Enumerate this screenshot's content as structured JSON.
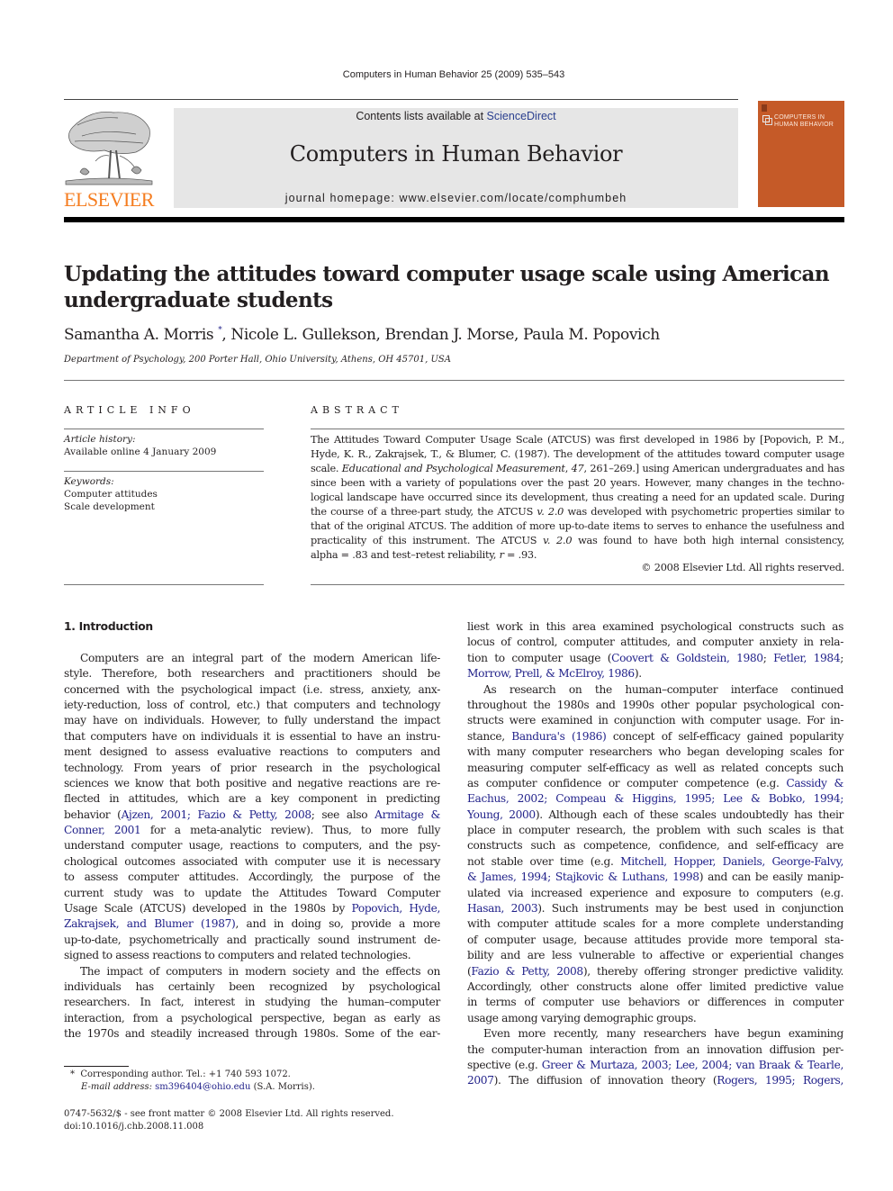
{
  "running_head": "Computers in Human Behavior 25 (2009) 535–543",
  "publisher": {
    "logo_word": "ELSEVIER",
    "logo_color": "#f57d20"
  },
  "masthead": {
    "contents_prefix": "Contents lists available at ",
    "contents_link": "ScienceDirect",
    "journal_title": "Computers in Human Behavior",
    "homepage": "journal homepage: www.elsevier.com/locate/comphumbeh",
    "background": "#e6e6e6"
  },
  "cover": {
    "title_line1": "COMPUTERS IN",
    "title_line2": "HUMAN BEHAVIOR",
    "color": "#c55a28"
  },
  "article": {
    "title": "Updating the attitudes toward computer usage scale using American undergraduate students",
    "authors": {
      "first": "Samantha A. Morris",
      "first_mark": "*",
      "rest": ", Nicole L. Gullekson, Brendan J. Morse, Paula M. Popovich"
    },
    "affiliation": "Department of Psychology, 200 Porter Hall, Ohio University, Athens, OH 45701, USA"
  },
  "article_info": {
    "heading": "ARTICLE INFO",
    "history_label": "Article history:",
    "history_value": "Available online 4 January 2009",
    "keywords_label": "Keywords:",
    "keywords": [
      "Computer attitudes",
      "Scale development"
    ]
  },
  "abstract": {
    "heading": "ABSTRACT",
    "lines": [
      "The Attitudes Toward Computer Usage Scale (ATCUS) was first developed in 1986 by [Popovich, P. M.,",
      "Hyde, K. R., Zakrajsek, T., & Blumer, C. (1987). The development of the attitudes toward computer usage",
      [
        "scale. ",
        {
          "i": "Educational and Psychological Measurement"
        },
        ", ",
        {
          "i": "47"
        },
        ", 261–269.] using American undergraduates and has"
      ],
      "since been with a variety of populations over the past 20 years. However, many changes in the techno-",
      "logical landscape have occurred since its development, thus creating a need for an updated scale. During",
      [
        "the course of a three-part study, the ATCUS ",
        {
          "i": "v. 2.0"
        },
        " was developed with psychometric properties similar to"
      ],
      "that of the original ATCUS. The addition of more up-to-date items to serves to enhance the usefulness and",
      [
        "practicality of this instrument. The ATCUS ",
        {
          "i": "v. 2.0"
        },
        " was found to have both high internal consistency,"
      ],
      [
        "alpha = .83 and test–retest reliability, ",
        {
          "i": "r"
        },
        " = .93."
      ]
    ],
    "copyright": "© 2008 Elsevier Ltd. All rights reserved."
  },
  "body": {
    "section_heading": "1. Introduction",
    "left_col": [
      {
        "t": "Computers are an integral part of the modern American life-",
        "ind": true
      },
      {
        "t": "style. Therefore, both researchers and practitioners should be"
      },
      {
        "t": "concerned with the psychological impact (i.e. stress, anxiety, anx-"
      },
      {
        "t": "iety-reduction, loss of control, etc.) that computers and technology"
      },
      {
        "t": "may have on individuals. However, to fully understand the impact"
      },
      {
        "t": "that computers have on individuals it is essential to have an instru-"
      },
      {
        "t": "ment designed to assess evaluative reactions to computers and"
      },
      {
        "t": "technology. From years of prior research in the psychological"
      },
      {
        "t": "sciences we know that both positive and negative reactions are re-"
      },
      {
        "t": "flected in attitudes, which are a key component in predicting"
      },
      {
        "p": [
          "behavior (",
          {
            "l": "Ajzen, 2001; Fazio & Petty, 2008"
          },
          "; see also ",
          {
            "l": "Armitage &"
          }
        ]
      },
      {
        "p": [
          {
            "l": "Conner, 2001"
          },
          " for a meta-analytic review). Thus, to more fully"
        ]
      },
      {
        "t": "understand computer usage, reactions to computers, and the psy-"
      },
      {
        "t": "chological outcomes associated with computer use it is necessary"
      },
      {
        "t": "to assess computer attitudes. Accordingly, the purpose of the"
      },
      {
        "t": "current study was to update the Attitudes Toward Computer"
      },
      {
        "p": [
          "Usage Scale (ATCUS) developed in the 1980s by ",
          {
            "l": "Popovich, Hyde,"
          }
        ]
      },
      {
        "p": [
          {
            "l": "Zakrajsek, and Blumer (1987)"
          },
          ", and in doing so, provide a more"
        ]
      },
      {
        "t": "up-to-date, psychometrically and practically sound instrument de-"
      },
      {
        "t": "signed to assess reactions to computers and related technologies.",
        "last": true
      },
      {
        "t": "The impact of computers in modern society and the effects on",
        "ind": true
      },
      {
        "t": "individuals has certainly been recognized by psychological"
      },
      {
        "t": "researchers. In fact, interest in studying the human–computer"
      },
      {
        "t": "interaction, from a psychological perspective, began as early as"
      },
      {
        "t": "the 1970s and steadily increased through 1980s. Some of the ear-"
      }
    ],
    "right_col": [
      {
        "t": "liest work in this area examined psychological constructs such as"
      },
      {
        "t": "locus of control, computer attitudes, and computer anxiety in rela-"
      },
      {
        "p": [
          "tion to computer usage (",
          {
            "l": "Coovert & Goldstein, 1980"
          },
          "; ",
          {
            "l": "Fetler, 1984"
          },
          ";"
        ]
      },
      {
        "p": [
          {
            "l": "Morrow, Prell, & McElroy, 1986"
          },
          ")."
        ],
        "last": true
      },
      {
        "t": "As research on the human–computer interface continued",
        "ind": true
      },
      {
        "t": "throughout the 1980s and 1990s other popular psychological con-"
      },
      {
        "t": "structs were examined in conjunction with computer usage. For in-"
      },
      {
        "p": [
          "stance, ",
          {
            "l": "Bandura's (1986)"
          },
          " concept of self-efficacy gained popularity"
        ]
      },
      {
        "t": "with many computer researchers who began developing scales for"
      },
      {
        "t": "measuring computer self-efficacy as well as related concepts such"
      },
      {
        "p": [
          "as computer confidence or computer competence (e.g. ",
          {
            "l": "Cassidy &"
          }
        ]
      },
      {
        "p": [
          {
            "l": "Eachus, 2002; Compeau & Higgins, 1995; Lee & Bobko, 1994;"
          }
        ]
      },
      {
        "p": [
          {
            "l": "Young, 2000"
          },
          "). Although each of these scales undoubtedly has their"
        ]
      },
      {
        "t": "place in computer research, the problem with such scales is that"
      },
      {
        "t": "constructs such as competence, confidence, and self-efficacy are"
      },
      {
        "p": [
          "not stable over time (e.g. ",
          {
            "l": "Mitchell, Hopper, Daniels, George-Falvy,"
          }
        ]
      },
      {
        "p": [
          {
            "l": "& James, 1994; Stajkovic & Luthans, 1998"
          },
          ") and can be easily manip-"
        ]
      },
      {
        "t": "ulated via increased experience and exposure to computers (e.g."
      },
      {
        "p": [
          {
            "l": "Hasan, 2003"
          },
          "). Such instruments may be best used in conjunction"
        ]
      },
      {
        "t": "with computer attitude scales for a more complete understanding"
      },
      {
        "t": "of computer usage, because attitudes provide more temporal sta-"
      },
      {
        "t": "bility and are less vulnerable to affective or experiential changes"
      },
      {
        "p": [
          "(",
          {
            "l": "Fazio & Petty, 2008"
          },
          "), thereby offering stronger predictive validity."
        ]
      },
      {
        "t": "Accordingly, other constructs alone offer limited predictive value"
      },
      {
        "t": "in terms of computer use behaviors or differences in computer"
      },
      {
        "t": "usage among varying demographic groups.",
        "last": true
      },
      {
        "t": "Even more recently, many researchers have begun examining",
        "ind": true
      },
      {
        "t": "the computer-human interaction from an innovation diffusion per-"
      },
      {
        "p": [
          "spective (e.g. ",
          {
            "l": "Greer & Murtaza, 2003; Lee, 2004; van Braak & Tearle,"
          }
        ]
      },
      {
        "p": [
          {
            "l": "2007"
          },
          "). The diffusion of innovation theory (",
          {
            "l": "Rogers, 1995; Rogers,"
          }
        ]
      }
    ]
  },
  "footnote": {
    "mark": "*",
    "line1": "Corresponding author. Tel.: +1 740 593 1072.",
    "email_label": "E-mail address:",
    "email": "sm396404@ohio.edu",
    "email_suffix": " (S.A. Morris)."
  },
  "issn": {
    "line1": "0747-5632/$ - see front matter © 2008 Elsevier Ltd. All rights reserved.",
    "doi": "doi:10.1016/j.chb.2008.11.008"
  },
  "link_color": "#22228a"
}
